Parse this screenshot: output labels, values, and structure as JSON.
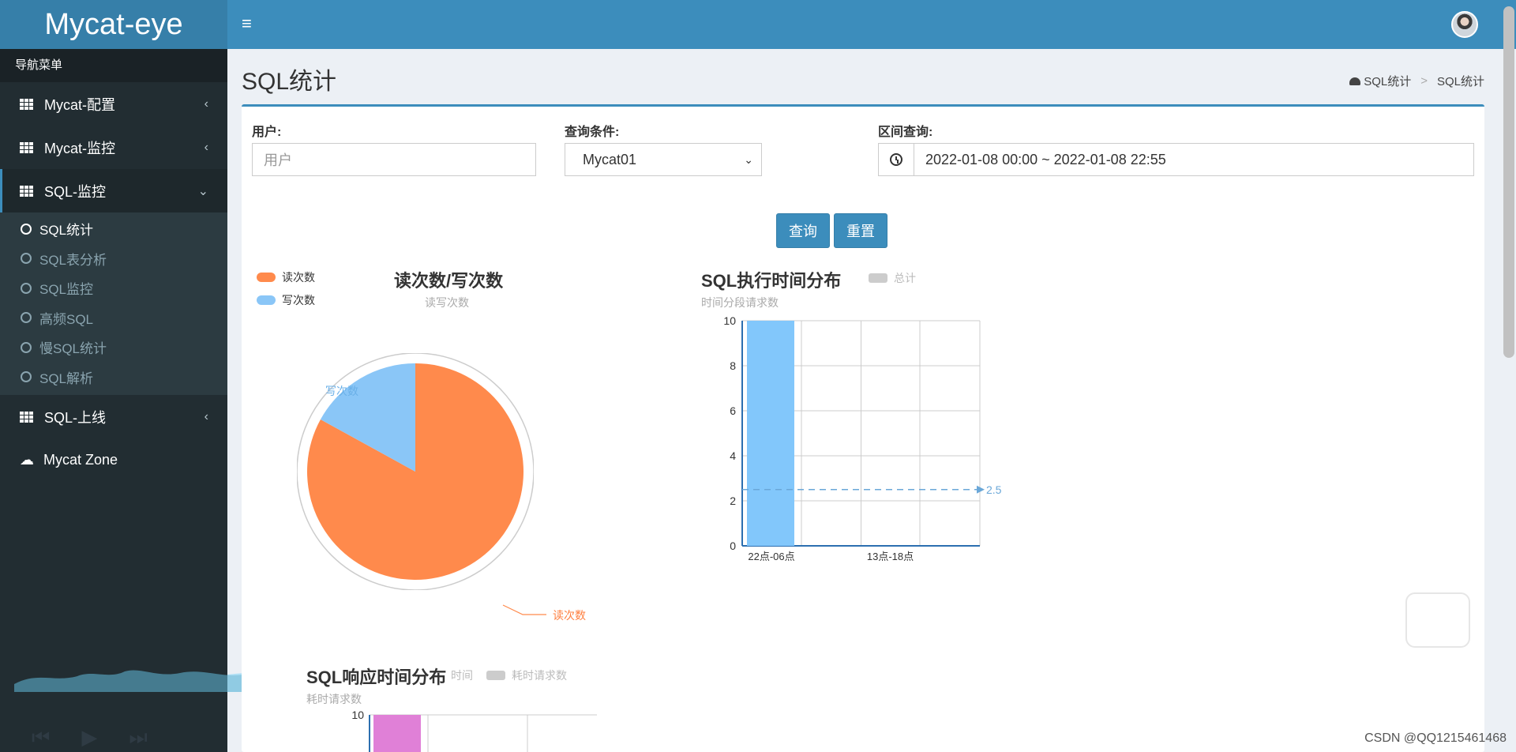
{
  "app": {
    "title": "Mycat-eye"
  },
  "sidebar": {
    "header": "导航菜单",
    "items": [
      {
        "label": "Mycat-配置",
        "chevron": "‹"
      },
      {
        "label": "Mycat-监控",
        "chevron": "‹"
      },
      {
        "label": "SQL-监控",
        "chevron": "⌄"
      },
      {
        "label": "SQL-上线",
        "chevron": "‹"
      },
      {
        "label": "Mycat Zone"
      }
    ],
    "submenu": [
      "SQL统计",
      "SQL表分析",
      "SQL监控",
      "高频SQL",
      "慢SQL统计",
      "SQL解析"
    ]
  },
  "page": {
    "title": "SQL统计"
  },
  "breadcrumb": {
    "home": "SQL统计",
    "current": "SQL统计",
    "sep": ">"
  },
  "form": {
    "user_label": "用户:",
    "user_placeholder": "用户",
    "cond_label": "查询条件:",
    "cond_value": "Mycat01",
    "range_label": "区间查询:",
    "range_value": "2022-01-08 00:00 ~ 2022-01-08 22:55",
    "query_btn": "查询",
    "reset_btn": "重置"
  },
  "colors": {
    "accent": "#3c8dbc",
    "read": "#ff8a4c",
    "write": "#8ac6f7",
    "bar": "#82c7fb",
    "resp_bar": "#e080d7"
  },
  "chart_data": [
    {
      "type": "pie",
      "title": "读次数/写次数",
      "subtitle": "读写次数",
      "legend": [
        "读次数",
        "写次数"
      ],
      "slices": [
        {
          "name": "读次数",
          "value": 83
        },
        {
          "name": "写次数",
          "value": 17
        }
      ]
    },
    {
      "type": "bar",
      "title": "SQL执行时间分布",
      "subtitle": "时间分段请求数",
      "legend": [
        "总计"
      ],
      "categories": [
        "22点-06点",
        "13点-18点"
      ],
      "yticks": [
        "0",
        "2",
        "4",
        "6",
        "8",
        "10"
      ],
      "ylim": [
        0,
        10
      ],
      "series": [
        {
          "name": "总计",
          "values": [
            10,
            0
          ]
        }
      ],
      "markline": {
        "value": 2.5,
        "label": "2.5"
      }
    },
    {
      "type": "bar",
      "title": "SQL响应时间分布",
      "subtitle": "耗时请求数",
      "legend": [
        "时间",
        "耗时请求数"
      ],
      "yticks": [
        "10"
      ],
      "ylim": [
        0,
        10
      ]
    }
  ],
  "watermark": "CSDN @QQ1215461468"
}
